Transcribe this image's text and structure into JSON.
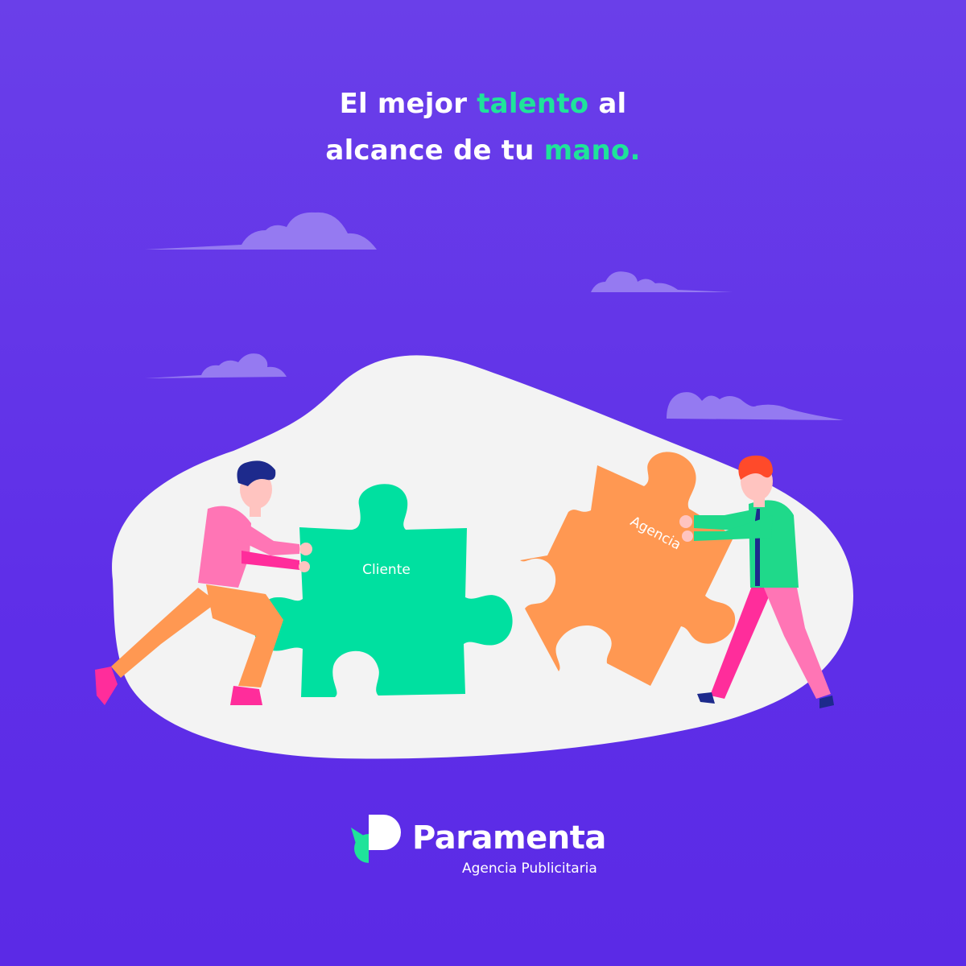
{
  "headline": {
    "line1": {
      "before": "El mejor ",
      "accent": "talento",
      "after": " al"
    },
    "line2": {
      "before": "alcance de tu ",
      "accent": "mano."
    }
  },
  "puzzle": {
    "left_label": "Cliente",
    "right_label": "Agencia"
  },
  "logo": {
    "brand": "Paramenta",
    "tagline": "Agencia Publicitaria"
  },
  "colors": {
    "background": "#5f2fe8",
    "accent_green": "#1fe39a",
    "puzzle_green": "#00e0a0",
    "puzzle_orange": "#ff9852",
    "blob": "#f3f3f3",
    "cloud": "#9a82f2"
  }
}
